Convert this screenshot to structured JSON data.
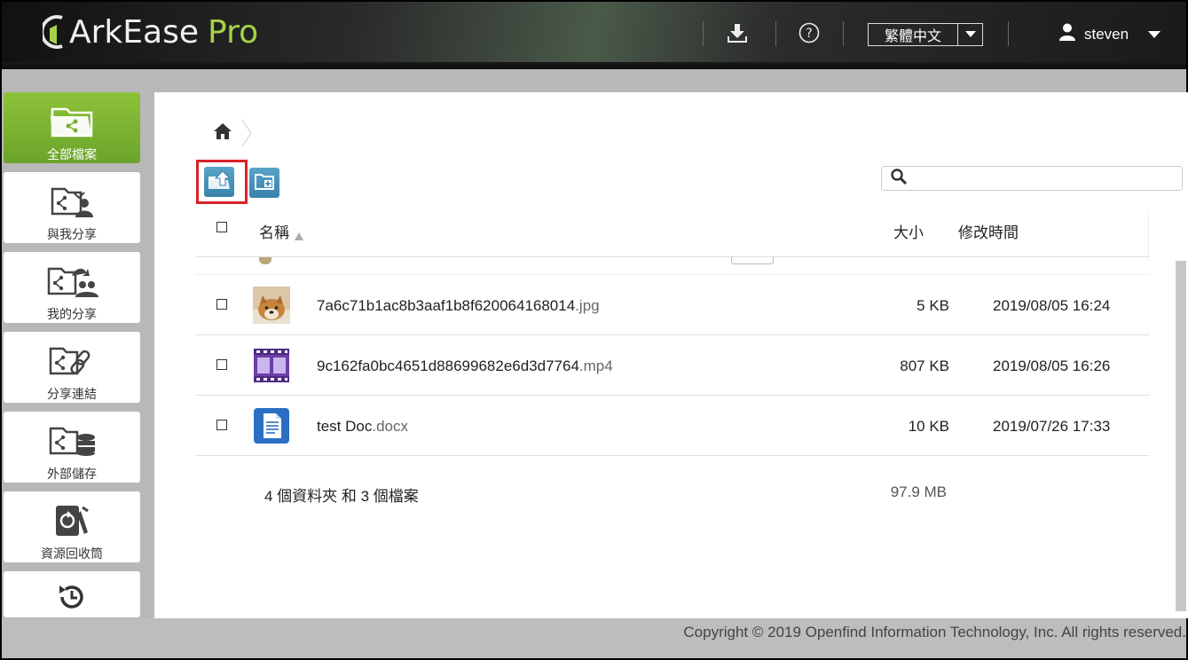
{
  "header": {
    "logo_text": "ArkEase",
    "logo_pro": "Pro",
    "download_icon": "download-icon",
    "help_icon": "help-icon",
    "language": "繁體中文",
    "user_name": "steven"
  },
  "sidebar": {
    "items": [
      {
        "label": "全部檔案",
        "icon": "all-files-icon",
        "active": true
      },
      {
        "label": "與我分享",
        "icon": "shared-with-me-icon"
      },
      {
        "label": "我的分享",
        "icon": "my-shares-icon"
      },
      {
        "label": "分享連結",
        "icon": "share-link-icon"
      },
      {
        "label": "外部儲存",
        "icon": "external-storage-icon"
      },
      {
        "label": "資源回收筒",
        "icon": "recycle-bin-icon"
      },
      {
        "label": "",
        "icon": "history-icon"
      }
    ]
  },
  "toolbar": {
    "upload_icon": "upload-icon",
    "new_folder_icon": "new-folder-icon",
    "search_placeholder": ""
  },
  "table": {
    "columns": {
      "name": "名稱",
      "size": "大小",
      "modified": "修改時間"
    },
    "rows": [
      {
        "name": "7a6c71b1ac8b3aaf1b8f620064168014",
        "ext": ".jpg",
        "size": "5 KB",
        "modified": "2019/08/05 16:24",
        "icon": "image-thumbnail"
      },
      {
        "name": "9c162fa0bc4651d88699682e6d3d7764",
        "ext": ".mp4",
        "size": "807 KB",
        "modified": "2019/08/05 16:26",
        "icon": "video-file-icon"
      },
      {
        "name": "test Doc",
        "ext": ".docx",
        "size": "10 KB",
        "modified": "2019/07/26 17:33",
        "icon": "document-file-icon"
      }
    ],
    "summary": "4 個資料夾 和 3 個檔案",
    "summary_size": "97.9 MB"
  },
  "footer": {
    "copyright": "Copyright © 2019 Openfind Information Technology, Inc. All rights reserved."
  },
  "colors": {
    "accent_green": "#8fc23a",
    "toolbar_blue": "#3782ac",
    "highlight_red": "#d9222a"
  }
}
